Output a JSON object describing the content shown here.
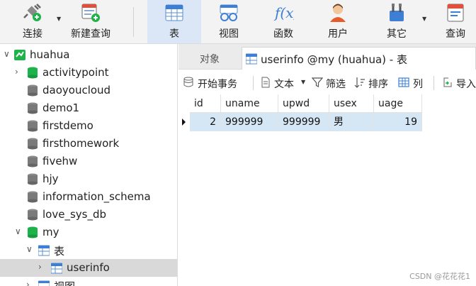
{
  "toolbar": {
    "connect_label": "连接",
    "new_query_label": "新建查询",
    "table_label": "表",
    "view_label": "视图",
    "function_label": "函数",
    "user_label": "用户",
    "other_label": "其它",
    "query_label": "查询",
    "function_glyph": "f(x)"
  },
  "tree": {
    "connection": "huahua",
    "databases": [
      "activitypoint",
      "daoyoucloud",
      "demo1",
      "firstdemo",
      "firsthomework",
      "fivehw",
      "hjy",
      "information_schema",
      "love_sys_db"
    ],
    "open_db": "my",
    "tables_node": "表",
    "selected_table": "userinfo",
    "views_node": "视图"
  },
  "tabs": {
    "objects_label": "对象",
    "active_label": "userinfo @my (huahua) - 表"
  },
  "subtoolbar": {
    "begin_tx": "开始事务",
    "text": "文本",
    "filter": "筛选",
    "sort": "排序",
    "columns": "列",
    "import": "导入"
  },
  "grid": {
    "columns": [
      "id",
      "uname",
      "upwd",
      "usex",
      "uage"
    ],
    "rows": [
      [
        "2",
        "999999",
        "999999",
        "男",
        "19"
      ]
    ]
  },
  "watermark": "CSDN @花花花1",
  "colors": {
    "accent": "#2a7fd4",
    "db_green": "#1db24a",
    "db_gray": "#7a7a7a",
    "selected_row": "#d5e6f5",
    "active_toolbar": "#dbe7f6"
  }
}
